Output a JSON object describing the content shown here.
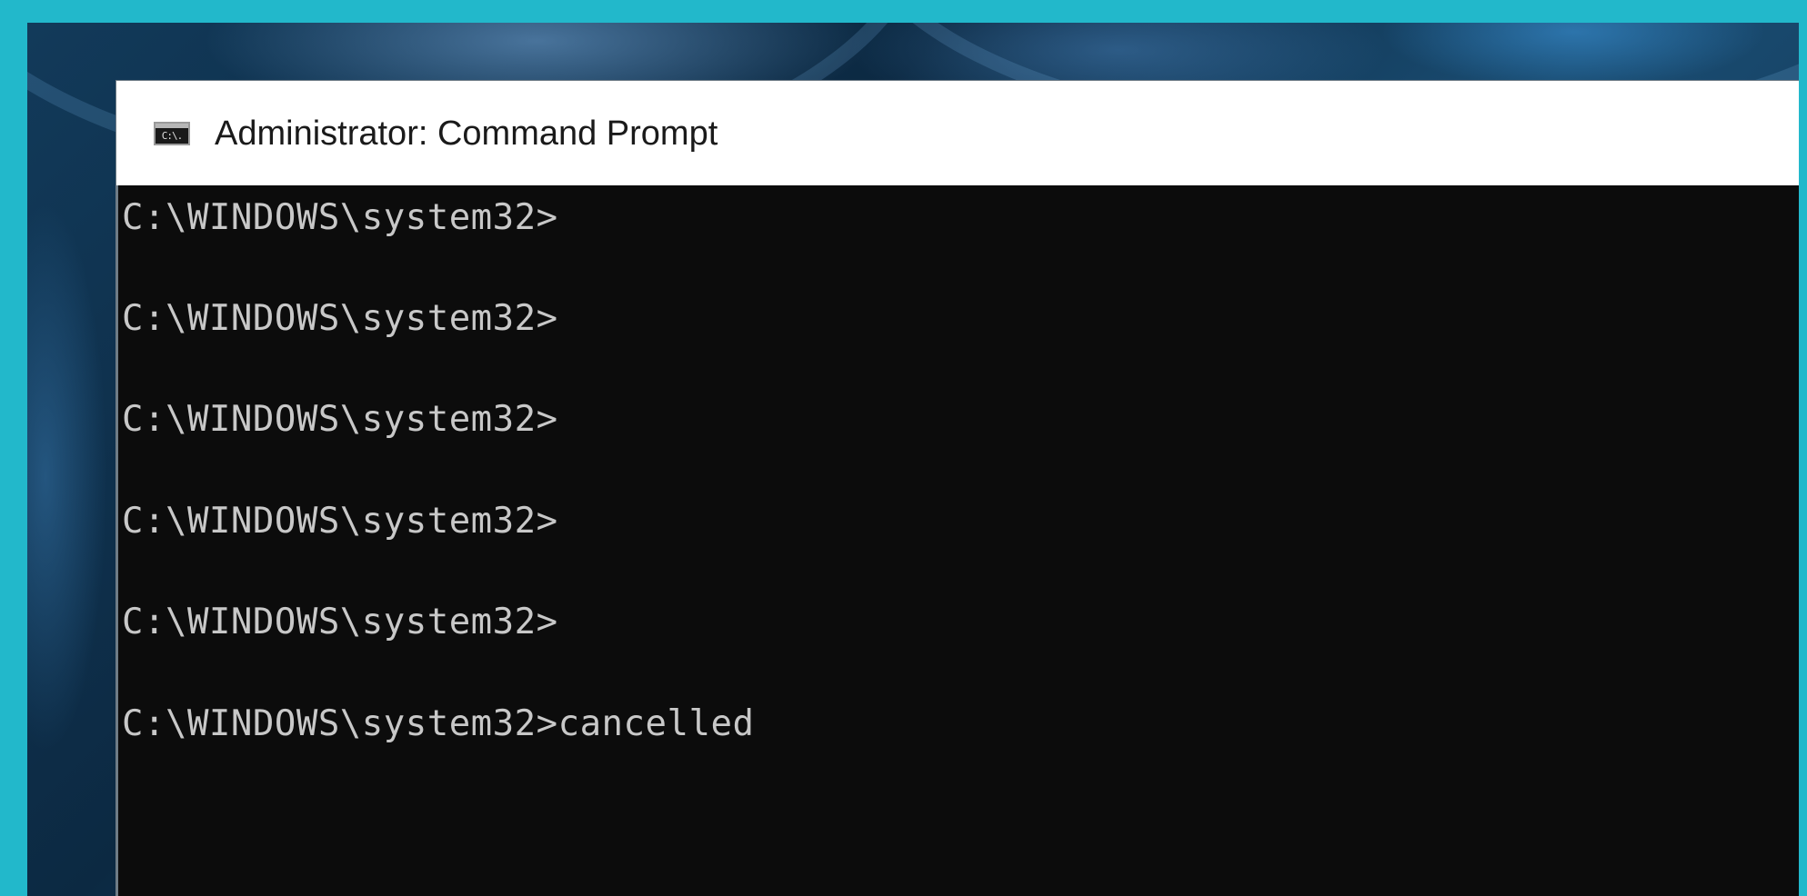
{
  "window": {
    "title": "Administrator: Command Prompt",
    "icon": "cmd-icon",
    "icon_glyph": "C:\\."
  },
  "console": {
    "lines": [
      "C:\\WINDOWS\\system32>",
      "C:\\WINDOWS\\system32>",
      "C:\\WINDOWS\\system32>",
      "C:\\WINDOWS\\system32>",
      "C:\\WINDOWS\\system32>",
      "C:\\WINDOWS\\system32>cancelled"
    ]
  },
  "colors": {
    "frame": "#22b8cb",
    "console_background": "#0c0c0c",
    "console_text": "#c8c8c8",
    "title_bar": "#ffffff"
  }
}
